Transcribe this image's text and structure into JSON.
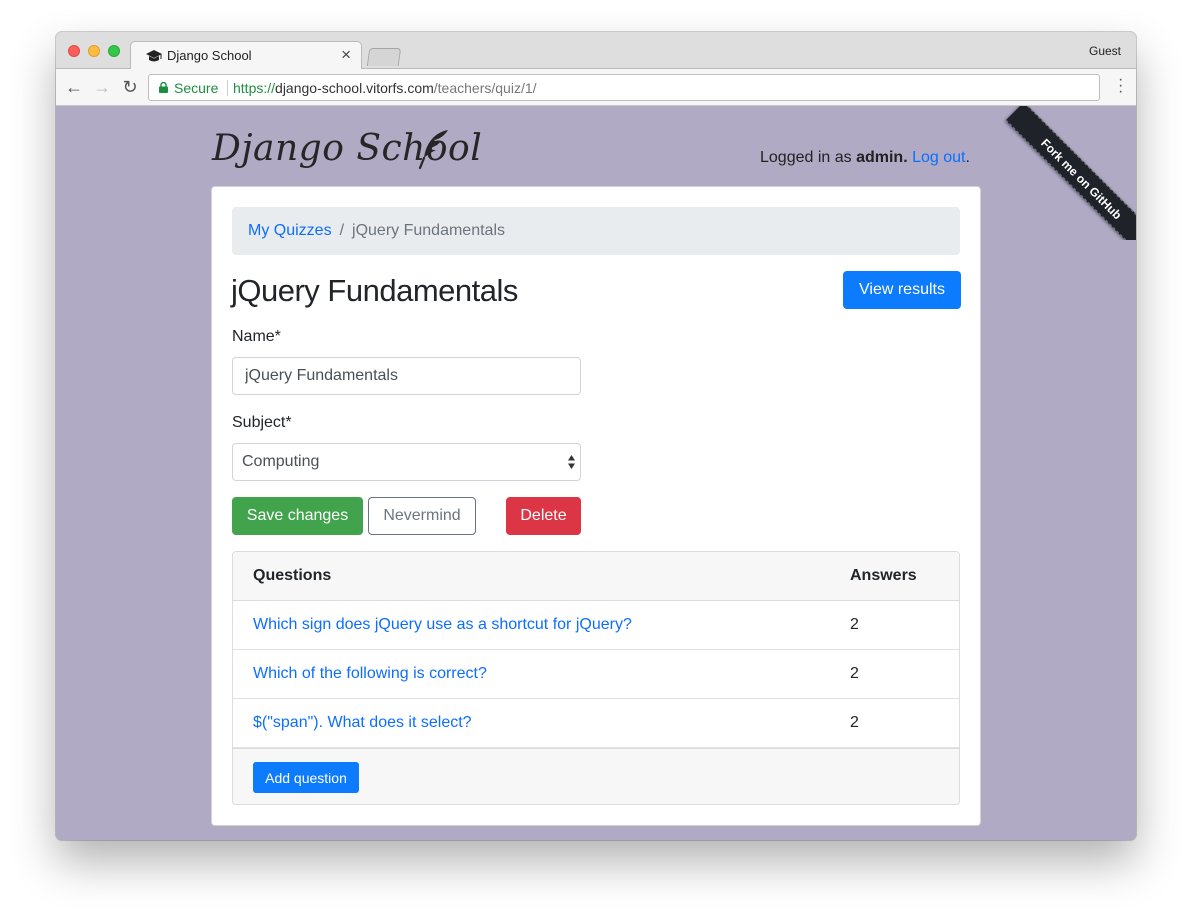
{
  "browser": {
    "tab_title": "Django School",
    "profile": "Guest",
    "secure_label": "Secure",
    "url_scheme": "https://",
    "url_host": "django-school.vitorfs.com",
    "url_path": "/teachers/quiz/1/"
  },
  "ribbon": {
    "label": "Fork me on GitHub"
  },
  "header": {
    "brand": "Django School",
    "login_prefix": "Logged in as ",
    "username": "admin.",
    "logout": "Log out",
    "login_suffix": "."
  },
  "breadcrumb": {
    "parent": "My Quizzes",
    "separator": "/",
    "current": "jQuery Fundamentals"
  },
  "page": {
    "title": "jQuery Fundamentals",
    "view_results": "View results"
  },
  "form": {
    "name_label": "Name*",
    "name_value": "jQuery Fundamentals",
    "subject_label": "Subject*",
    "subject_value": "Computing",
    "save": "Save changes",
    "nevermind": "Nevermind",
    "delete": "Delete"
  },
  "questions": {
    "col_questions": "Questions",
    "col_answers": "Answers",
    "rows": [
      {
        "text": "Which sign does jQuery use as a shortcut for jQuery?",
        "answers": "2"
      },
      {
        "text": "Which of the following is correct?",
        "answers": "2"
      },
      {
        "text": "$(\"span\"). What does it select?",
        "answers": "2"
      }
    ],
    "add_question": "Add question"
  },
  "colors": {
    "page_bg": "#b0aac4",
    "primary": "#0d7bfd",
    "success": "#41a34b",
    "danger": "#dc3545"
  }
}
